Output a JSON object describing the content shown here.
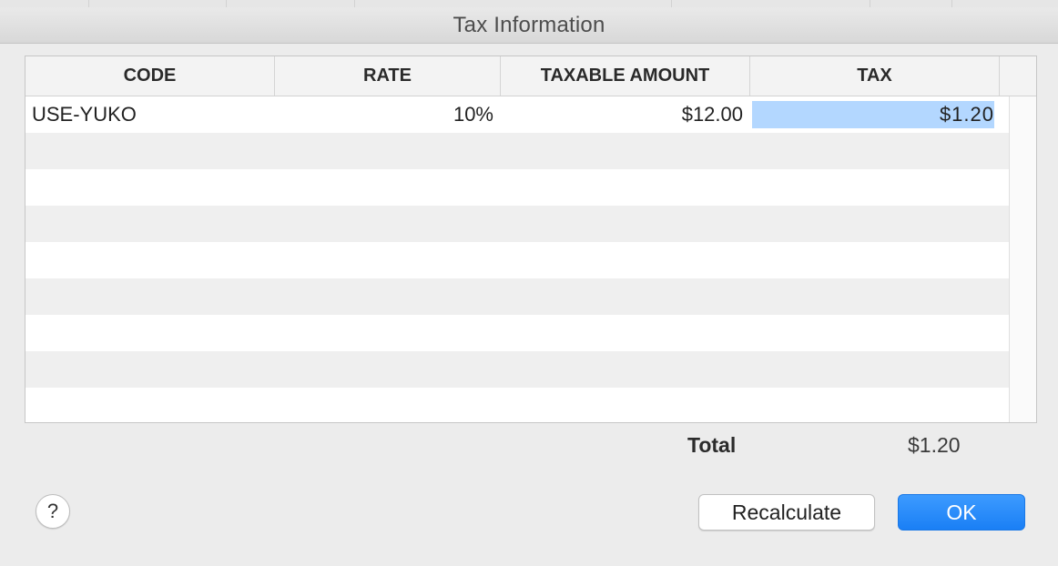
{
  "window": {
    "title": "Tax Information"
  },
  "table": {
    "columns": [
      "CODE",
      "RATE",
      "TAXABLE AMOUNT",
      "TAX"
    ],
    "rows": [
      {
        "code": "USE-YUKO",
        "rate": "10%",
        "taxable_amount": "$12.00",
        "tax": "$1.20"
      }
    ],
    "selected_cell": "tax"
  },
  "footer": {
    "total_label": "Total",
    "total_value": "$1.20"
  },
  "buttons": {
    "help": "?",
    "recalculate": "Recalculate",
    "ok": "OK"
  },
  "colors": {
    "selection": "#b3d7ff",
    "primary_button": "#1a7ff5"
  }
}
